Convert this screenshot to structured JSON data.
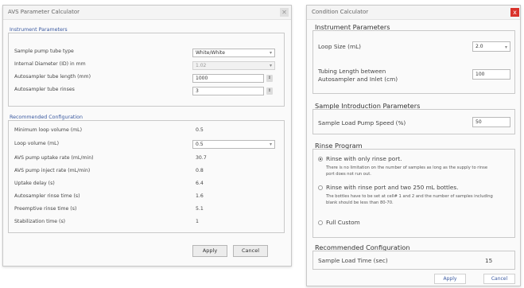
{
  "left_window": {
    "title": "AVS Parameter Calculator",
    "instrument_section": "Instrument Parameters",
    "rows": [
      {
        "label": "Sample pump tube type",
        "value": "White/White"
      },
      {
        "label": "Internal Diameter (ID) in mm",
        "value": "1.02"
      },
      {
        "label": "Autosampler tube length (mm)",
        "value": "1000"
      },
      {
        "label": "Autosampler tube rinses",
        "value": "3"
      }
    ],
    "recommended_section": "Recommended Configuration",
    "results": [
      {
        "label": "Minimum loop volume (mL)",
        "value": "0.5"
      },
      {
        "label": "Loop volume (mL)",
        "value": "0.5"
      },
      {
        "label": "AVS pump uptake rate (mL/min)",
        "value": "30.7"
      },
      {
        "label": "AVS pump inject rate (mL/min)",
        "value": "0.8"
      },
      {
        "label": "Uptake delay (s)",
        "value": "6.4"
      },
      {
        "label": "Autosampler rinse time (s)",
        "value": "1.6"
      },
      {
        "label": "Preemptive rinse time (s)",
        "value": "5.1"
      },
      {
        "label": "Stabilization time (s)",
        "value": "1"
      }
    ],
    "apply_label": "Apply",
    "cancel_label": "Cancel"
  },
  "right_window": {
    "title": "Condition Calculator",
    "close_glyph": "x",
    "instrument_section": "Instrument Parameters",
    "loop_size_label": "Loop Size (mL)",
    "loop_size_value": "2.0",
    "tubing_label_1": "Tubing Length between",
    "tubing_label_2": "Autosampler and Inlet (cm)",
    "tubing_value": "100",
    "sample_section": "Sample Introduction Parameters",
    "pump_speed_label": "Sample Load Pump Speed (%)",
    "pump_speed_value": "50",
    "rinse_section": "Rinse Program",
    "rinse_opt1": "Rinse with only rinse port.",
    "rinse_opt1_desc": "There is no limitation on the number of samples as long as the supply to rinse port does not run out.",
    "rinse_opt2": "Rinse with rinse port and two 250 mL bottles.",
    "rinse_opt2_desc": "The bottles have to be set at cell# 1 and 2 and the number of samples including blank should be less than 80-70.",
    "rinse_opt3": "Full Custom",
    "recommended_section": "Recommended Configuration",
    "load_time_label": "Sample Load Time (sec)",
    "load_time_value": "15",
    "apply_label": "Apply",
    "cancel_label": "Cancel"
  },
  "colors": {
    "section_blue": "#3a59a0",
    "close_red": "#d9322b"
  }
}
